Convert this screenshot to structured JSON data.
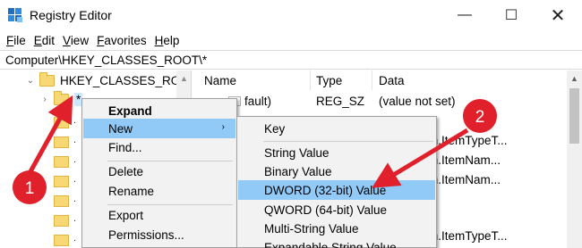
{
  "window": {
    "title": "Registry Editor"
  },
  "titlebar_buttons": {
    "minimize": "—",
    "maximize": "☐",
    "close": "✕"
  },
  "menu": [
    {
      "ul": "F",
      "rest": "ile"
    },
    {
      "ul": "E",
      "rest": "dit"
    },
    {
      "ul": "V",
      "rest": "iew"
    },
    {
      "ul": "F",
      "rest": "avorites"
    },
    {
      "ul": "H",
      "rest": "elp"
    }
  ],
  "address": "Computer\\HKEY_CLASSES_ROOT\\*",
  "tree": {
    "root_label": "HKEY_CLASSES_ROOT",
    "selected_label": "*",
    "stub_label": "."
  },
  "list": {
    "headers": {
      "name": "Name",
      "type": "Type",
      "data": "Data"
    },
    "rows": [
      {
        "name": "(Default)",
        "name_visible": "fault)",
        "type": "REG_SZ",
        "data": "(value not set)"
      },
      {
        "data": "m.ItemTypeT..."
      },
      {
        "data": "m.ItemNam..."
      },
      {
        "data": "m.ItemNam..."
      },
      {
        "data": ""
      },
      {
        "data": ""
      },
      {
        "data": ""
      },
      {
        "data": "m.ItemTypeT..."
      }
    ]
  },
  "context_menu": {
    "items": [
      "Expand",
      "New",
      "Find...",
      "Delete",
      "Rename",
      "Export",
      "Permissions..."
    ],
    "submenu_arrow": "›"
  },
  "submenu": {
    "items": [
      "Key",
      "String Value",
      "Binary Value",
      "DWORD (32-bit) Value",
      "QWORD (64-bit) Value",
      "Multi-String Value",
      "Expandable String Value"
    ]
  },
  "annotations": [
    {
      "label": "1",
      "color": "#e0202a"
    },
    {
      "label": "2",
      "color": "#e0202a"
    }
  ],
  "colors": {
    "highlight": "#91c9f7",
    "selection": "#cce8ff",
    "annotation": "#e0202a"
  }
}
